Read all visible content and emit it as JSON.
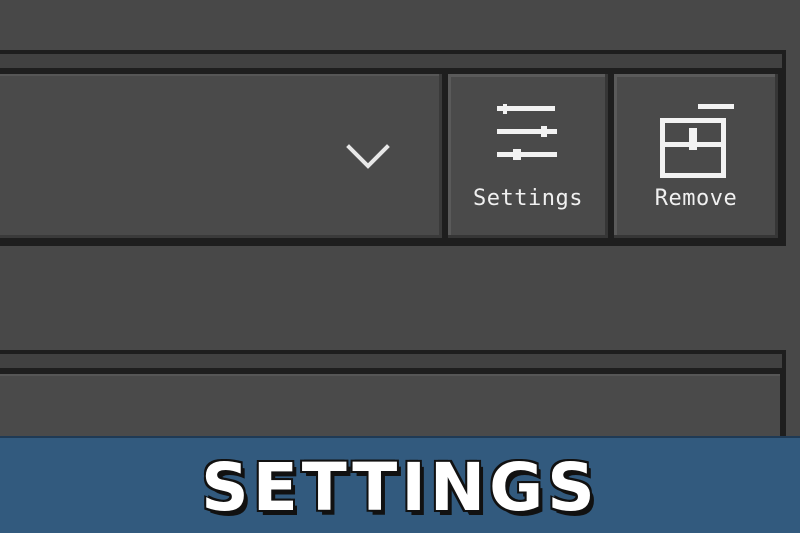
{
  "toolbar": {
    "settings_label": "Settings",
    "remove_label": "Remove",
    "settings_icon": "sliders-icon",
    "remove_icon": "trash-can-icon",
    "dropdown_icon": "chevron-down-icon"
  },
  "banner": {
    "title": "SETTINGS"
  },
  "colors": {
    "background": "#484848",
    "panel": "#4a4a4a",
    "frame": "#1e1e1e",
    "banner": "#325a7e",
    "text": "#f0f0f0"
  }
}
